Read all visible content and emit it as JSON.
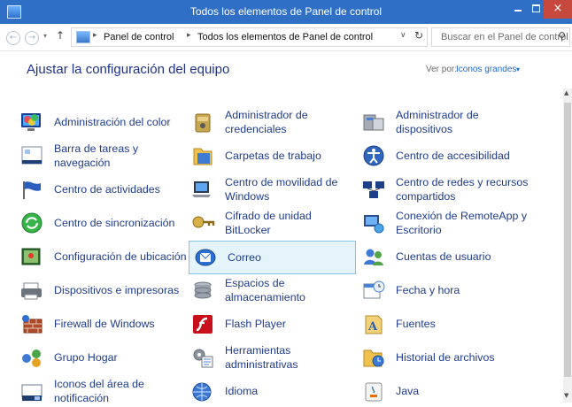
{
  "window": {
    "title": "Todos los elementos de Panel de control",
    "close_glyph": "×"
  },
  "navigation": {
    "back_glyph": "←",
    "forward_glyph": "→",
    "recent_glyph": "▾",
    "up_glyph": "↑",
    "breadcrumb": [
      "Panel de control",
      "Todos los elementos de Panel de control"
    ],
    "separator_glyph": "▸",
    "dropdown_glyph": "∨",
    "refresh_glyph": "↻",
    "search_placeholder": "Buscar en el Panel de control",
    "search_glyph": "⚲"
  },
  "header": {
    "title": "Ajustar la configuración del equipo",
    "view_by_label": "Ver por:",
    "view_by_value": "Iconos grandes",
    "view_by_arrow": "▾"
  },
  "items": [
    {
      "label": "Administración del color",
      "icon": "color-management-icon"
    },
    {
      "label": "Administrador de credenciales",
      "icon": "credential-manager-icon"
    },
    {
      "label": "Administrador de dispositivos",
      "icon": "device-manager-icon"
    },
    {
      "label": "Barra de tareas y navegación",
      "icon": "taskbar-icon"
    },
    {
      "label": "Carpetas de trabajo",
      "icon": "work-folders-icon"
    },
    {
      "label": "Centro de accesibilidad",
      "icon": "accessibility-icon"
    },
    {
      "label": "Centro de actividades",
      "icon": "action-center-flag-icon"
    },
    {
      "label": "Centro de movilidad de Windows",
      "icon": "mobility-center-icon"
    },
    {
      "label": "Centro de redes y recursos compartidos",
      "icon": "network-center-icon"
    },
    {
      "label": "Centro de sincronización",
      "icon": "sync-center-icon"
    },
    {
      "label": "Cifrado de unidad BitLocker",
      "icon": "bitlocker-key-icon"
    },
    {
      "label": "Conexión de RemoteApp y Escritorio",
      "icon": "remoteapp-icon"
    },
    {
      "label": "Configuración de ubicación",
      "icon": "location-settings-icon"
    },
    {
      "label": "Correo",
      "icon": "mail-icon"
    },
    {
      "label": "Cuentas de usuario",
      "icon": "user-accounts-icon"
    },
    {
      "label": "Dispositivos e impresoras",
      "icon": "printer-icon"
    },
    {
      "label": "Espacios de almacenamiento",
      "icon": "storage-spaces-icon"
    },
    {
      "label": "Fecha y hora",
      "icon": "date-time-icon"
    },
    {
      "label": "Firewall de Windows",
      "icon": "firewall-icon"
    },
    {
      "label": "Flash Player",
      "icon": "flash-player-icon"
    },
    {
      "label": "Fuentes",
      "icon": "fonts-icon"
    },
    {
      "label": "Grupo Hogar",
      "icon": "homegroup-icon"
    },
    {
      "label": "Herramientas administrativas",
      "icon": "admin-tools-icon"
    },
    {
      "label": "Historial de archivos",
      "icon": "file-history-icon"
    },
    {
      "label": "Iconos del área de notificación",
      "icon": "notification-area-icon"
    },
    {
      "label": "Idioma",
      "icon": "language-icon"
    },
    {
      "label": "Java",
      "icon": "java-icon"
    }
  ],
  "selected_item": "Correo",
  "scrollbar": {
    "up_glyph": "▲",
    "down_glyph": "▼"
  },
  "colors": {
    "titlebar": "#2f6fc6",
    "close_button": "#c7483c",
    "link": "#1f3c8c",
    "accent": "#1e6ac4",
    "selection_bg": "#e5f3fb",
    "selection_border": "#84c4e8"
  }
}
